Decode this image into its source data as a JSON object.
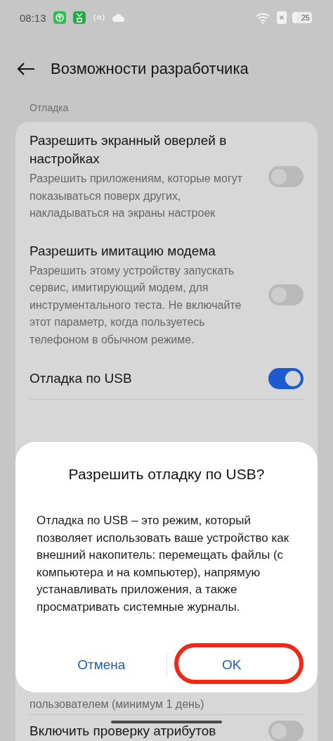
{
  "status_bar": {
    "time": "08:13",
    "battery": "25"
  },
  "header": {
    "title": "Возможности разработчика"
  },
  "section": {
    "label": "Отладка"
  },
  "settings": [
    {
      "kind": "toggle",
      "title": "Разрешить экранный оверлей в настройках",
      "subtitle": "Разрешить приложениям, которые могут показываться поверх других, накладываться на экраны настроек",
      "on": false
    },
    {
      "kind": "toggle",
      "title": "Разрешить имитацию модема",
      "subtitle": "Разрешить этому устройству запускать сервис, имитирующий модем, для инструментального теста. Не включайте этот параметр, когда пользуетесь телефоном в обычном режиме.",
      "on": false
    },
    {
      "kind": "toggle",
      "title": "Отладка по USB",
      "on": true
    },
    {
      "kind": "text",
      "subtitle": "пользователем (минимум 1 день)"
    },
    {
      "kind": "toggle",
      "title": "Включить проверку атрибутов",
      "on": false
    }
  ],
  "dialog": {
    "title": "Разрешить отладку по USB?",
    "message": "Отладка по USB – это режим, который позволяет использовать ваше устройство как внешний накопитель: перемещать файлы (с компьютера и на компьютер), напрямую устанавливать приложения, а также просматривать системные журналы.",
    "buttons": [
      {
        "label": "Отмена",
        "highlighted": false
      },
      {
        "label": "OK",
        "highlighted": true
      }
    ]
  }
}
